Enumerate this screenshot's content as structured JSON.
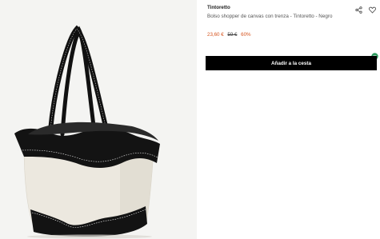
{
  "product": {
    "image_alt": "Bolso shopper de canvas con trenza - Tintoretto - Negro",
    "brand": "Tintoretto",
    "title": "Bolso shopper de canvas con trenza - Tintoretto - Negro",
    "price_current": "23,60 €",
    "price_old": "59 €",
    "discount": "60%",
    "add_to_cart_label": "Añadir a la cesta"
  },
  "icons": {
    "share": "share-icon",
    "wishlist": "heart-icon",
    "chat": "chat-icon"
  },
  "colors": {
    "price": "#d6541f",
    "button_bg": "#000000",
    "chat_accent": "#2e9b5f"
  }
}
